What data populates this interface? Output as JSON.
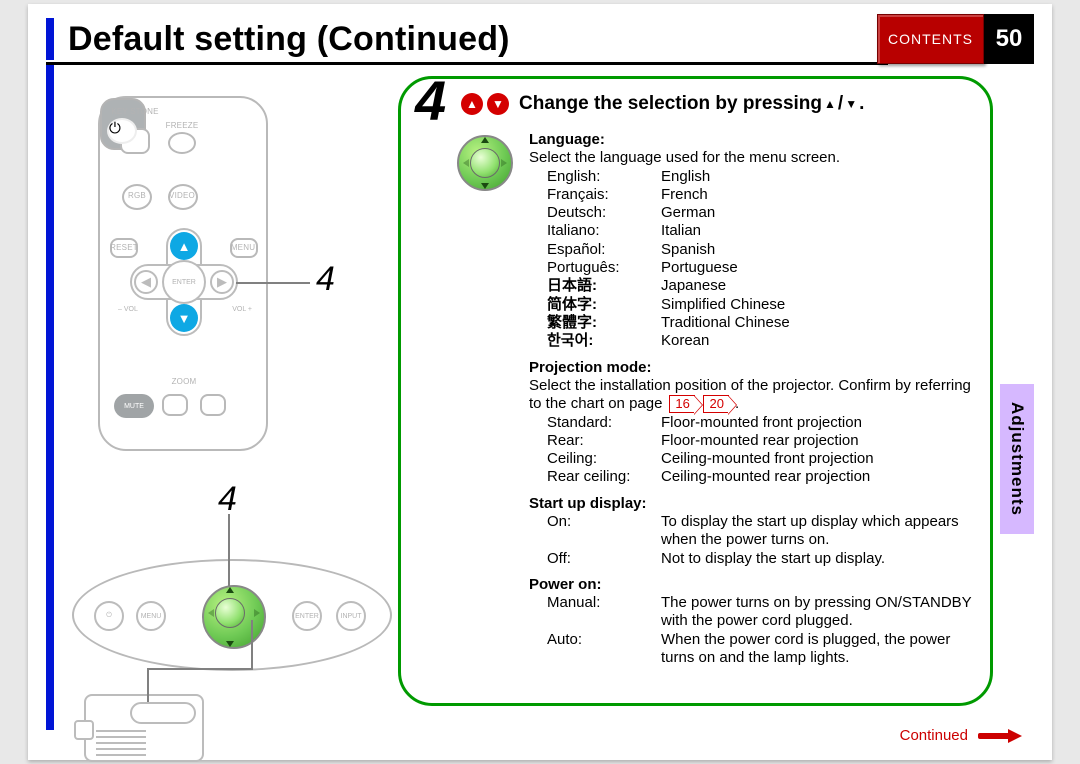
{
  "page_title": "Default setting (Continued)",
  "page_number": "50",
  "contents_label": "CONTENTS",
  "side_tab": "Adjustments",
  "continued_label": "Continued",
  "marker_numbers": {
    "remote": "4",
    "panel": "4"
  },
  "main": {
    "step_number": "4",
    "step_title_prefix": "Change the selection by pressing ",
    "step_title_sep": " / ",
    "step_title_suffix": ".",
    "language_heading": "Language",
    "language_desc": "Select the language used for the menu screen.",
    "languages": [
      {
        "key": "English:",
        "key_native": false,
        "val": "English"
      },
      {
        "key": "Français:",
        "key_native": false,
        "val": "French"
      },
      {
        "key": "Deutsch:",
        "key_native": false,
        "val": "German"
      },
      {
        "key": "Italiano:",
        "key_native": false,
        "val": "Italian"
      },
      {
        "key": "Español:",
        "key_native": false,
        "val": "Spanish"
      },
      {
        "key": "Português:",
        "key_native": false,
        "val": "Portuguese"
      },
      {
        "key": "日本語:",
        "key_native": true,
        "val": "Japanese"
      },
      {
        "key": "简体字:",
        "key_native": true,
        "val": "Simplified Chinese"
      },
      {
        "key": "繁體字:",
        "key_native": true,
        "val": "Traditional Chinese"
      },
      {
        "key": "한국어:",
        "key_native": true,
        "val": "Korean"
      }
    ],
    "projection_heading": "Projection mode",
    "projection_desc_pre": "Select the installation position of the projector. Confirm by referring to the chart on page ",
    "projection_page_links": [
      "16",
      "20"
    ],
    "projection_desc_post": ".",
    "projection_modes": [
      {
        "key": "Standard:",
        "val": "Floor-mounted front projection"
      },
      {
        "key": "Rear:",
        "val": "Floor-mounted rear projection"
      },
      {
        "key": "Ceiling:",
        "val": "Ceiling-mounted front projection"
      },
      {
        "key": "Rear ceiling:",
        "val": "Ceiling-mounted rear projection"
      }
    ],
    "startup_heading": "Start up display",
    "startup_options": [
      {
        "key": "On:",
        "val": "To display the start up display which appears when the power turns on."
      },
      {
        "key": "Off:",
        "val": "Not to display the start up display."
      }
    ],
    "poweron_heading": "Power on",
    "poweron_options": [
      {
        "key": "Manual:",
        "val": "The power turns on by pressing ON/STANDBY with the power cord plugged."
      },
      {
        "key": "Auto:",
        "val": "When the power cord is plugged, the power turns on and the lamp lights."
      }
    ]
  },
  "remote_labels": {
    "keystone": "KEY\nSTONE",
    "freeze": "FREEZE",
    "onstandby": "ON/\nSTANDBY",
    "rgb": "RGB",
    "video": "VIDEO",
    "reset": "RESET",
    "menu": "MENU",
    "enter": "ENTER",
    "vol_minus": "– VOL",
    "vol_plus": "VOL +",
    "zoom": "ZOOM",
    "mute": "MUTE",
    "minus": "–",
    "plus": "+"
  },
  "panel_labels": {
    "menu": "MENU",
    "enter": "ENTER",
    "input": "INPUT"
  }
}
